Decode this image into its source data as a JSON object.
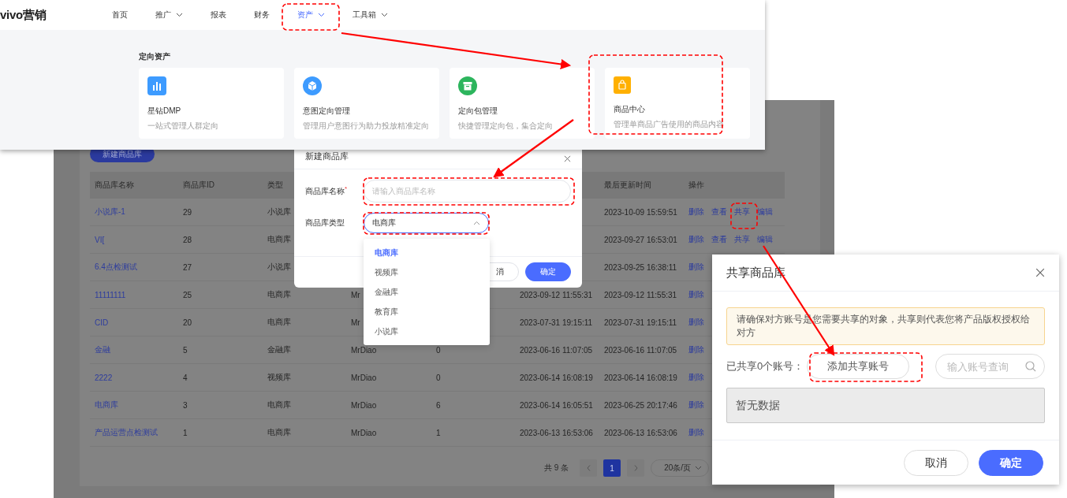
{
  "top_screen": {
    "logo": "vivo营销",
    "nav": [
      {
        "label": "首页",
        "selected": false,
        "has_menu": false
      },
      {
        "label": "推广",
        "selected": false,
        "has_menu": true
      },
      {
        "label": "报表",
        "selected": false,
        "has_menu": false
      },
      {
        "label": "财务",
        "selected": false,
        "has_menu": false
      },
      {
        "label": "资产",
        "selected": true,
        "has_menu": true
      },
      {
        "label": "工具箱",
        "selected": false,
        "has_menu": true
      }
    ],
    "section_title": "定向资产",
    "cards": [
      {
        "kind": "chart",
        "title": "星钻DMP",
        "desc": "一站式管理人群定向"
      },
      {
        "kind": "cube",
        "title": "意图定向管理",
        "desc": "管理用户意图行为助力投放精准定向"
      },
      {
        "kind": "box",
        "title": "定向包管理",
        "desc": "快捷管理定向包，集合定向"
      },
      {
        "kind": "bag",
        "title": "商品中心",
        "desc": "管理单商品广告使用的商品内容"
      }
    ]
  },
  "list_screen": {
    "create_button": "新建商品库",
    "headers": {
      "name": "商品库名称",
      "id": "商品库ID",
      "type": "类型",
      "updated": "最后更新时间",
      "actions": "操作"
    },
    "rows": [
      {
        "name": "小说库-1",
        "id": "29",
        "type": "小说库",
        "updated": "2023-10-09 15:59:51",
        "actions": [
          "删除",
          "查看",
          "共享",
          "编辑"
        ]
      },
      {
        "name": "VI[",
        "id": "28",
        "type": "电商库",
        "updated": "2023-09-27 16:53:01",
        "actions": [
          "删除",
          "查看",
          "共享",
          "编辑"
        ]
      },
      {
        "name": "6.4点检测试",
        "id": "27",
        "type": "小说库",
        "updated": "2023-09-25 16:38:11",
        "actions": [
          "删除"
        ]
      },
      {
        "name": "11111111",
        "id": "25",
        "type": "电商库",
        "column_4": "Mr",
        "column_6": "2023-09-12 11:55:31",
        "updated": "2023-09-12 11:55:31",
        "actions": [
          "删除"
        ]
      },
      {
        "name": "CID",
        "id": "20",
        "type": "电商库",
        "column_4": "Mr",
        "column_6": "2023-07-31 19:15:11",
        "updated": "2023-07-31 19:15:11",
        "actions": [
          "删除"
        ]
      },
      {
        "name": "金融",
        "id": "5",
        "type": "金融库",
        "column_4": "MrDiao",
        "column_5": "0",
        "column_6": "2023-06-16 11:07:05",
        "updated": "2023-06-16 11:07:05",
        "actions": [
          "删除"
        ]
      },
      {
        "name": "2222",
        "id": "4",
        "type": "视频库",
        "column_4": "MrDiao",
        "column_5": "0",
        "column_6": "2023-06-14 16:08:19",
        "updated": "2023-06-14 16:08:19",
        "actions": [
          "删除"
        ]
      },
      {
        "name": "电商库",
        "id": "3",
        "type": "电商库",
        "column_4": "MrDiao",
        "column_5": "6",
        "column_6": "2023-06-14 16:05:51",
        "updated": "2023-06-25 20:17:46",
        "actions": [
          "删除"
        ]
      },
      {
        "name": "产品运营点检测试",
        "id": "1",
        "type": "电商库",
        "column_4": "MrDiao",
        "column_5": "1",
        "column_6": "2023-06-13 16:53:06",
        "updated": "2023-06-13 16:53:06",
        "actions": [
          "删除"
        ]
      }
    ],
    "pagination": {
      "total": "共 9 条",
      "pages": [
        {
          "label": "1",
          "selected": true
        }
      ],
      "page_size": "20条/页"
    }
  },
  "create_dialog": {
    "title": "新建商品库",
    "fields": [
      {
        "kind": "input",
        "label": "商品库名称$^{*}$",
        "placeholder": "请输入商品库名称"
      },
      {
        "kind": "select",
        "label": "商品库类型",
        "value": "电商库"
      }
    ],
    "options": [
      {
        "label": "电商库",
        "selected": true
      },
      {
        "label": "视频库",
        "selected": false
      },
      {
        "label": "金融库",
        "selected": false
      },
      {
        "label": "教育库",
        "selected": false
      },
      {
        "label": "小说库",
        "selected": false
      }
    ],
    "buttons": [
      {
        "kind": "cancel",
        "label": "消"
      },
      {
        "kind": "primary",
        "label": "确定"
      }
    ]
  },
  "share_dialog": {
    "title": "共享商品库",
    "notice": "请确保对方账号是您需要共享的对象，共享则代表您将产品版权授权给对方",
    "shared_label": "已共享0个账号：",
    "add_button": "添加共享账号",
    "search": {
      "placeholder": "输入账号查询"
    },
    "empty_text": "暂无数据",
    "buttons": [
      {
        "kind": "cancel",
        "label": "取消"
      },
      {
        "kind": "primary",
        "label": "确定"
      }
    ]
  }
}
